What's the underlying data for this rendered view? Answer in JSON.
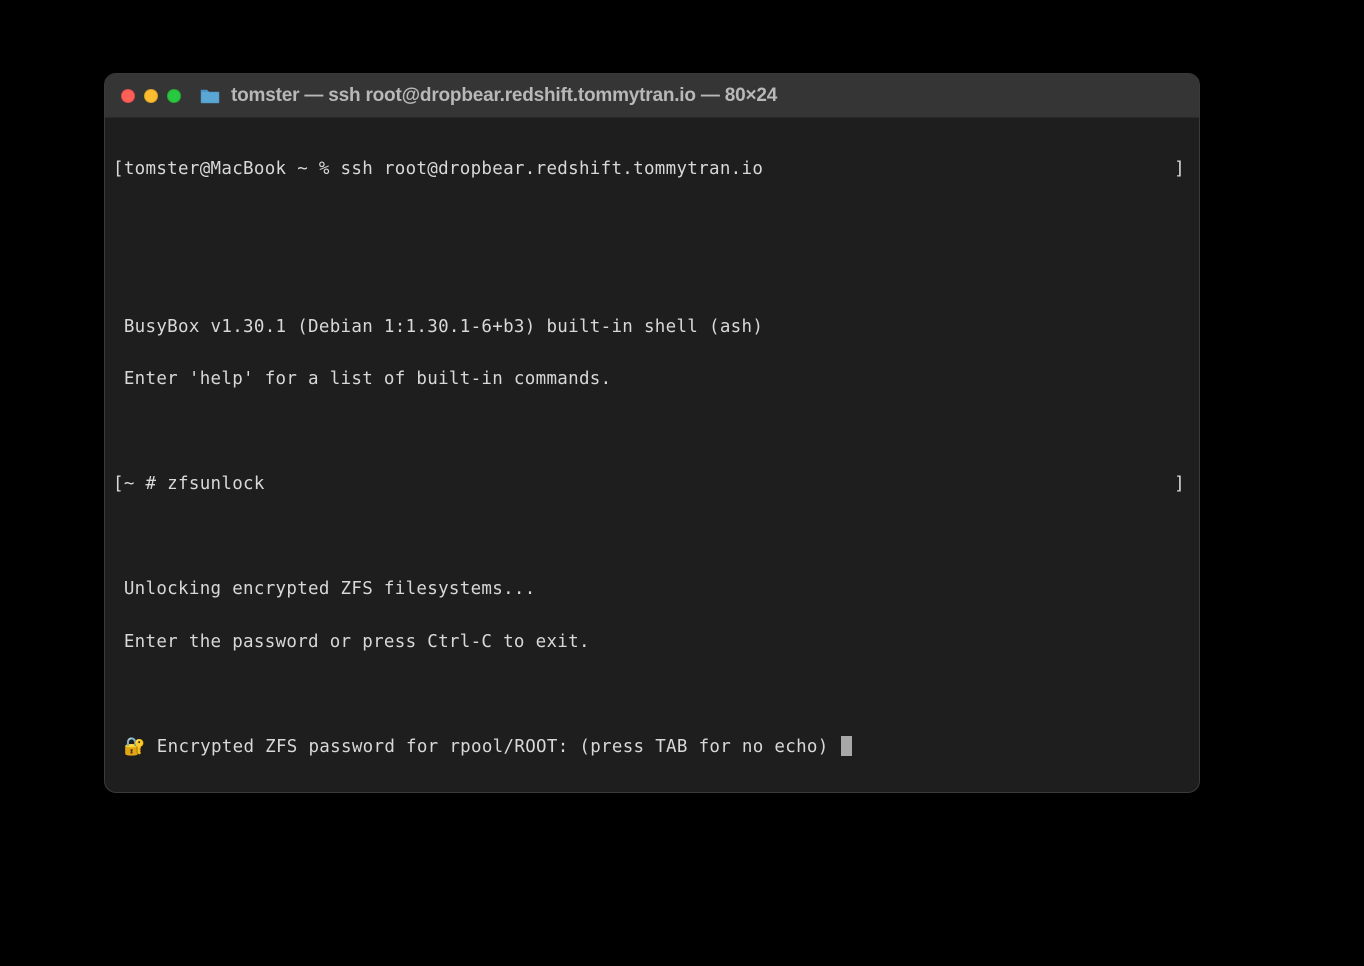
{
  "window": {
    "title": "tomster — ssh root@dropbear.redshift.tommytran.io — 80×24"
  },
  "terminal": {
    "line1_prefix": "[",
    "line1_prompt": "tomster@MacBook ~ % ssh root@dropbear.redshift.tommytran.io",
    "line1_suffix": "]",
    "busybox1": "BusyBox v1.30.1 (Debian 1:1.30.1-6+b3) built-in shell (ash)",
    "busybox2": "Enter 'help' for a list of built-in commands.",
    "line2_prefix": "[",
    "line2_prompt": "~ # zfsunlock",
    "line2_suffix": "]",
    "unlock1": "Unlocking encrypted ZFS filesystems...",
    "unlock2": "Enter the password or press Ctrl-C to exit.",
    "lock_emoji": "🔐",
    "password_prompt": " Encrypted ZFS password for rpool/ROOT: (press TAB for no echo) "
  }
}
